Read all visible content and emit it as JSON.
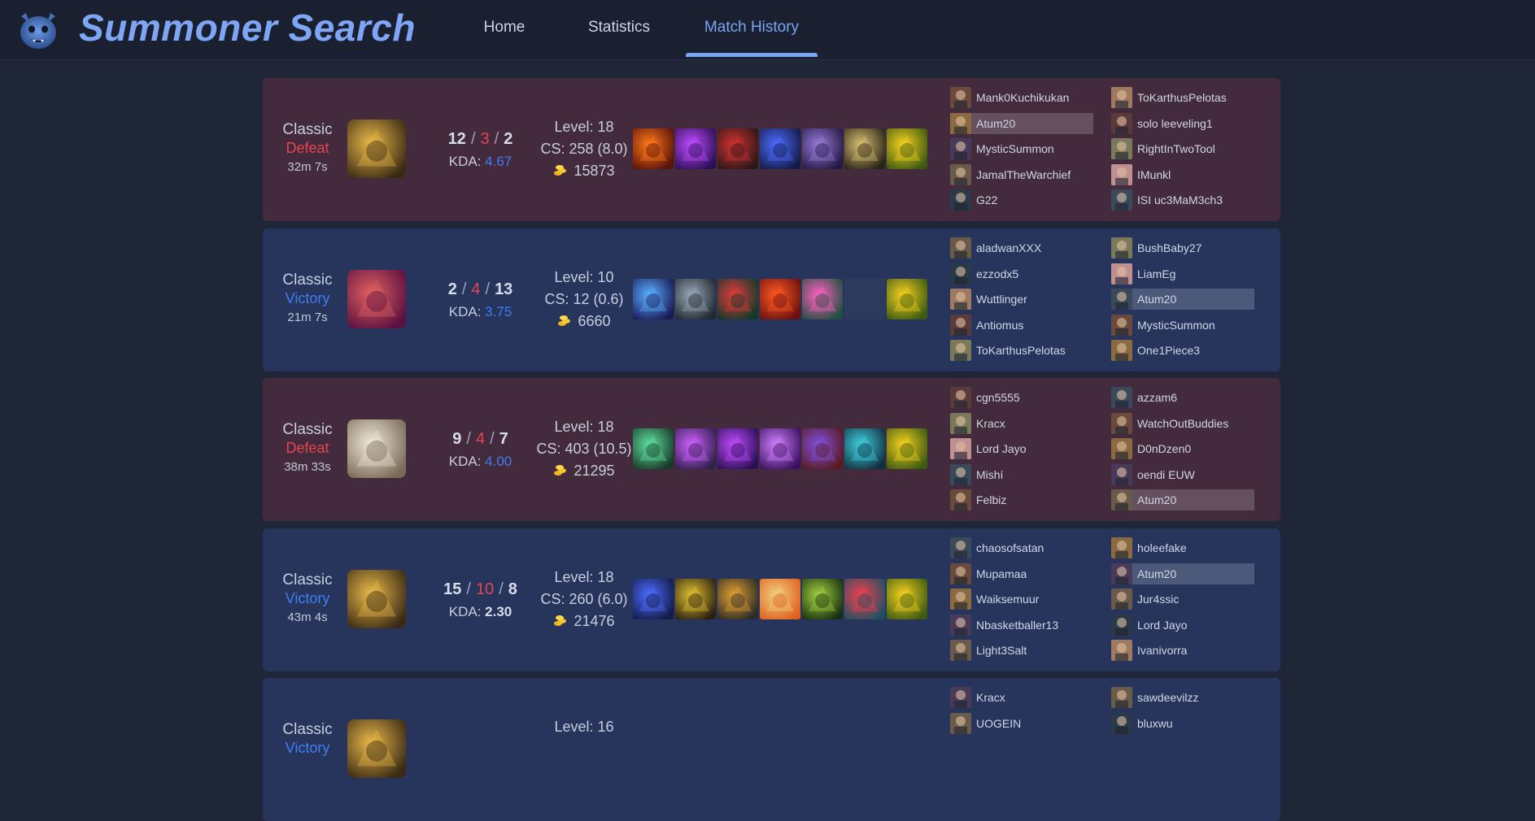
{
  "app": {
    "title": "Summoner Search",
    "nav": [
      {
        "label": "Home",
        "active": false
      },
      {
        "label": "Statistics",
        "active": false
      },
      {
        "label": "Match History",
        "active": true
      }
    ]
  },
  "colors": {
    "background": "#1e2638",
    "header": "#1a2030",
    "accent": "#79a6f2",
    "defeat_card": "#432a3c",
    "victory_card": "#27355d",
    "defeat_text": "#e44650",
    "victory_text": "#3d7ff0"
  },
  "matches": [
    {
      "mode": "Classic",
      "result": "Defeat",
      "duration": "32m 7s",
      "kills": "12",
      "deaths": "3",
      "assists": "2",
      "kda_label": "KDA:",
      "kda": "4.67",
      "level": "Level: 18",
      "cs": "CS: 258 (8.0)",
      "gold": "15873",
      "champion_icon": "champion-portrait-gold",
      "items": [
        "flame-blade-icon",
        "purple-crescent-icon",
        "red-cleaver-icon",
        "blue-shuriken-icon",
        "purple-cloak-icon",
        "boots-icon",
        "gold-ward-icon"
      ],
      "team1": [
        "Mank0Kuchikukan",
        "Atum20",
        "MysticSummon",
        "JamalTheWarchief",
        "G22"
      ],
      "team2": [
        "ToKarthusPelotas",
        "solo leeveling1",
        "RightInTwoTool",
        "IMunkl",
        "ISI uc3MaM3ch3"
      ]
    },
    {
      "mode": "Classic",
      "result": "Victory",
      "duration": "21m 7s",
      "kills": "2",
      "deaths": "4",
      "assists": "13",
      "kda_label": "KDA:",
      "kda": "3.75",
      "level": "Level: 10",
      "cs": "CS: 12 (0.6)",
      "gold": "6660",
      "champion_icon": "champion-portrait-red",
      "items": [
        "crystal-blade-icon",
        "eye-orb-icon",
        "red-boots-icon",
        "red-swirl-icon",
        "pink-gem-icon",
        "empty-slot",
        "gold-ward-icon"
      ],
      "team1": [
        "aladwanXXX",
        "ezzodx5",
        "Wuttlinger",
        "Antiomus",
        "ToKarthusPelotas"
      ],
      "team2": [
        "BushBaby27",
        "LiamEg",
        "Atum20",
        "MysticSummon",
        "One1Piece3"
      ]
    },
    {
      "mode": "Classic",
      "result": "Defeat",
      "duration": "38m 33s",
      "kills": "9",
      "deaths": "4",
      "assists": "7",
      "kda_label": "KDA:",
      "kda": "4.00",
      "level": "Level: 18",
      "cs": "CS: 403 (10.5)",
      "gold": "21295",
      "champion_icon": "champion-portrait-white",
      "items": [
        "green-blade-icon",
        "golden-orb-icon",
        "purple-crescent-icon",
        "purple-spear-icon",
        "witch-hat-icon",
        "cyan-armor-icon",
        "gold-ward-icon"
      ],
      "team1": [
        "cgn5555",
        "Kracx",
        "Lord Jayo",
        "Mishí",
        "Felbiz"
      ],
      "team2": [
        "azzam6",
        "WatchOutBuddies",
        "D0nDzen0",
        "oendi EUW",
        "Atum20"
      ]
    },
    {
      "mode": "Classic",
      "result": "Victory",
      "duration": "43m 4s",
      "kills": "15",
      "deaths": "10",
      "assists": "8",
      "kda_label": "KDA:",
      "kda": "2.30",
      "level": "Level: 18",
      "cs": "CS: 260 (6.0)",
      "gold": "21476",
      "champion_icon": "champion-portrait-gold",
      "items": [
        "blue-shuriken-icon",
        "gold-blade-icon",
        "gold-cannon-icon",
        "star-lance-icon",
        "green-bow-icon",
        "red-wing-icon",
        "gold-ward-icon"
      ],
      "team1": [
        "chaosofsatan",
        "Mupamaa",
        "Waiksemuur",
        "Nbasketballer13",
        "Light3Salt"
      ],
      "team2": [
        "holeefake",
        "Atum20",
        "Jur4ssic",
        "Lord Jayo",
        "Ivanivorra"
      ]
    },
    {
      "mode": "Classic",
      "result": "Victory",
      "duration": "",
      "kills": "",
      "deaths": "",
      "assists": "",
      "kda_label": "",
      "kda": "",
      "level": "Level: 16",
      "cs": "",
      "gold": "",
      "champion_icon": "champion-portrait-gold",
      "items": [],
      "team1": [
        "Kracx",
        "UOGEIN"
      ],
      "team2": [
        "sawdeevilzz",
        "bluxwu"
      ]
    }
  ]
}
